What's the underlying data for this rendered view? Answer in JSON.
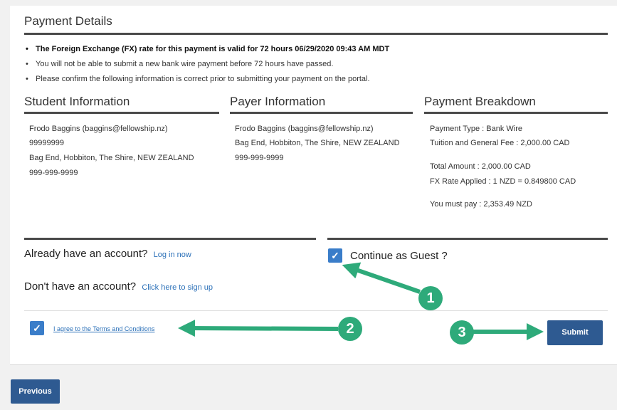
{
  "payment_details": {
    "title": "Payment Details",
    "bullets": [
      "The Foreign Exchange (FX) rate for this payment is valid for 72 hours 06/29/2020 09:43 AM MDT",
      "You will not be able to submit a new bank wire payment before 72 hours have passed.",
      "Please confirm the following information is correct prior to submitting your payment on the portal."
    ]
  },
  "student": {
    "heading": "Student Information",
    "lines": [
      "Frodo Baggins (baggins@fellowship.nz)",
      "99999999",
      "Bag End, Hobbiton, The Shire, NEW ZEALAND",
      "999-999-9999"
    ]
  },
  "payer": {
    "heading": "Payer Information",
    "lines": [
      "Frodo Baggins (baggins@fellowship.nz)",
      "Bag End, Hobbiton, The Shire, NEW ZEALAND",
      "999-999-9999"
    ]
  },
  "breakdown": {
    "heading": "Payment Breakdown",
    "payment_type": "Payment Type : Bank Wire",
    "tuition": "Tuition and General Fee : 2,000.00 CAD",
    "total": "Total Amount : 2,000.00 CAD",
    "fx_rate": "FX Rate Applied : 1 NZD = 0.849800 CAD",
    "must_pay": "You must pay : 2,353.49 NZD"
  },
  "account": {
    "have_account": "Already have an account?",
    "login_link": "Log in now",
    "no_account": "Don't have an account?",
    "signup_link": "Click here to sign up",
    "guest_label": "Continue as Guest ?",
    "guest_checked": true
  },
  "terms": {
    "label": "I agree to the Terms and Conditions",
    "checked": true
  },
  "buttons": {
    "submit": "Submit",
    "previous": "Previous"
  },
  "annotations": {
    "badge_1": "1",
    "badge_2": "2",
    "badge_3": "3"
  },
  "colors": {
    "accent": "#3a7dc9",
    "button": "#2e5a91",
    "link": "#2b70b8",
    "annotation": "#2eaa7a",
    "rule": "#4a4a4a"
  },
  "icons": {
    "checkbox_checked": "check-icon"
  }
}
